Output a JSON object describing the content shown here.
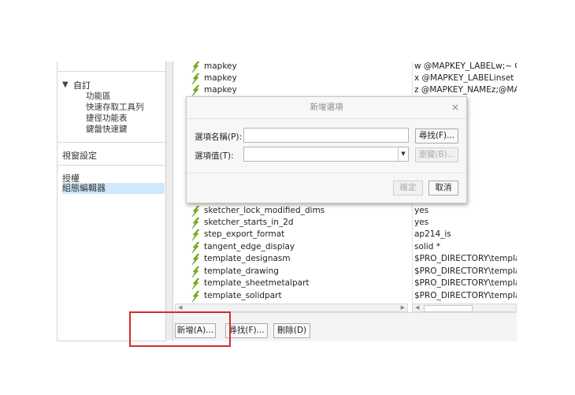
{
  "nav": {
    "tree_header": "自訂",
    "tree_items": [
      "功能區",
      "快速存取工具列",
      "捷徑功能表",
      "鍵盤快速鍵"
    ],
    "items": [
      "視窗設定",
      "授權",
      "組態編輯器"
    ]
  },
  "options": [
    {
      "name": "mapkey",
      "value": "w @MAPKEY_LABELw;~ Co"
    },
    {
      "name": "mapkey",
      "value": "x @MAPKEY_LABELinset dra"
    },
    {
      "name": "mapkey",
      "value": "z @MAPKEY_NAMEz;@MA"
    },
    {
      "name": "sketcher_lock_modified_dims",
      "value": "yes"
    },
    {
      "name": "sketcher_starts_in_2d",
      "value": "yes"
    },
    {
      "name": "step_export_format",
      "value": "ap214_is"
    },
    {
      "name": "tangent_edge_display",
      "value": "solid *"
    },
    {
      "name": "template_designasm",
      "value": "$PRO_DIRECTORY\\templat"
    },
    {
      "name": "template_drawing",
      "value": "$PRO_DIRECTORY\\templat"
    },
    {
      "name": "template_sheetmetalpart",
      "value": "$PRO_DIRECTORY\\templat"
    },
    {
      "name": "template_solidpart",
      "value": "$PRO_DIRECTORY\\templat"
    }
  ],
  "buttons": {
    "add": "新增(A)...",
    "find": "尋找(F)...",
    "delete": "刪除(D)"
  },
  "dialog": {
    "title": "新增選項",
    "close": "×",
    "name_label": "選項名稱(P):",
    "value_label": "選項值(T):",
    "find_button": "尋找(F)...",
    "browse_button": "瀏覽(B)...",
    "ok_button": "確定",
    "cancel_button": "取消",
    "name_value": "",
    "option_value": ""
  },
  "colors": {
    "selection": "#cfe8fb",
    "highlight_box": "#d42b2b",
    "bolt_icon": "#7ab800"
  }
}
